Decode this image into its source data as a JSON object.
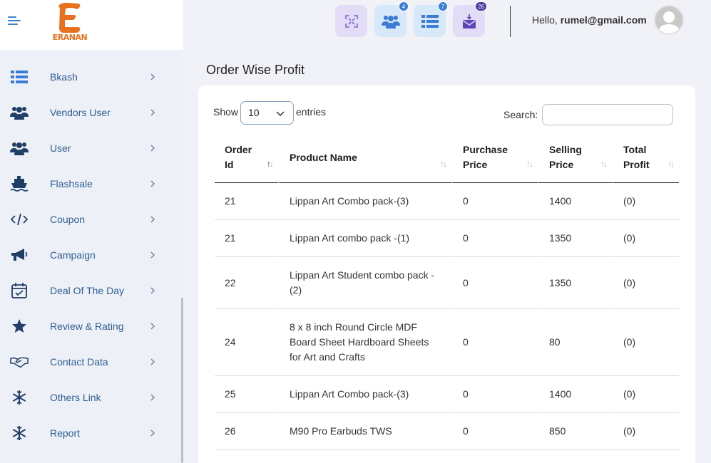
{
  "brand": {
    "logo_text": "ERANAN"
  },
  "sidebar": {
    "items": [
      {
        "label": "Bkash",
        "icon": "list-icon"
      },
      {
        "label": "Vendors User",
        "icon": "users-icon"
      },
      {
        "label": "User",
        "icon": "users-icon"
      },
      {
        "label": "Flashsale",
        "icon": "ship-icon"
      },
      {
        "label": "Coupon",
        "icon": "code-icon"
      },
      {
        "label": "Campaign",
        "icon": "megaphone-icon"
      },
      {
        "label": "Deal Of The Day",
        "icon": "calendar-check-icon"
      },
      {
        "label": "Review & Rating",
        "icon": "star-icon"
      },
      {
        "label": "Contact Data",
        "icon": "handshake-icon"
      },
      {
        "label": "Others Link",
        "icon": "snowflake-icon"
      },
      {
        "label": "Report",
        "icon": "snowflake-icon"
      }
    ]
  },
  "topbar": {
    "badges": {
      "users": "4",
      "orders": "7",
      "messages": "26"
    },
    "greeting_prefix": "Hello, ",
    "email": "rumel@gmail.com"
  },
  "main": {
    "title": "Order Wise Profit",
    "show_label": "Show",
    "entries_value": "10",
    "entries_label": "entries",
    "search_label": "Search:",
    "search_value": "",
    "columns": [
      {
        "line1": "Order",
        "line2": "Id"
      },
      {
        "line1": "Product Name",
        "line2": ""
      },
      {
        "line1": "Purchase",
        "line2": "Price"
      },
      {
        "line1": "Selling",
        "line2": "Price"
      },
      {
        "line1": "Total",
        "line2": "Profit"
      }
    ],
    "rows": [
      {
        "order_id": "21",
        "product": [
          "Lippan Art Combo pack-(3)"
        ],
        "purchase": "0",
        "selling": "1400",
        "profit": "(0)"
      },
      {
        "order_id": "21",
        "product": [
          "Lippan Art combo pack -(1)"
        ],
        "purchase": "0",
        "selling": "1350",
        "profit": "(0)"
      },
      {
        "order_id": "22",
        "product": [
          "Lippan Art Student combo pack -",
          "(2)"
        ],
        "purchase": "0",
        "selling": "1350",
        "profit": "(0)"
      },
      {
        "order_id": "24",
        "product": [
          "8 x 8 inch Round Circle MDF",
          "Board Sheet Hardboard Sheets",
          "for Art and Crafts"
        ],
        "purchase": "0",
        "selling": "80",
        "profit": "(0)"
      },
      {
        "order_id": "25",
        "product": [
          "Lippan Art Combo pack-(3)"
        ],
        "purchase": "0",
        "selling": "1400",
        "profit": "(0)"
      },
      {
        "order_id": "26",
        "product": [
          "M90 Pro Earbuds TWS"
        ],
        "purchase": "0",
        "selling": "850",
        "profit": "(0)"
      }
    ]
  },
  "colors": {
    "sidebar_bg": "#eef0f8",
    "menu_text": "#2e5f8f",
    "icon_dark": "#1f3f66",
    "accent_purple": "#e3dcf7",
    "accent_blue": "#d7e8f8",
    "logo_orange": "#e8711f",
    "badge_blue": "#3a7bd5",
    "badge_purple": "#4b3aa0"
  }
}
